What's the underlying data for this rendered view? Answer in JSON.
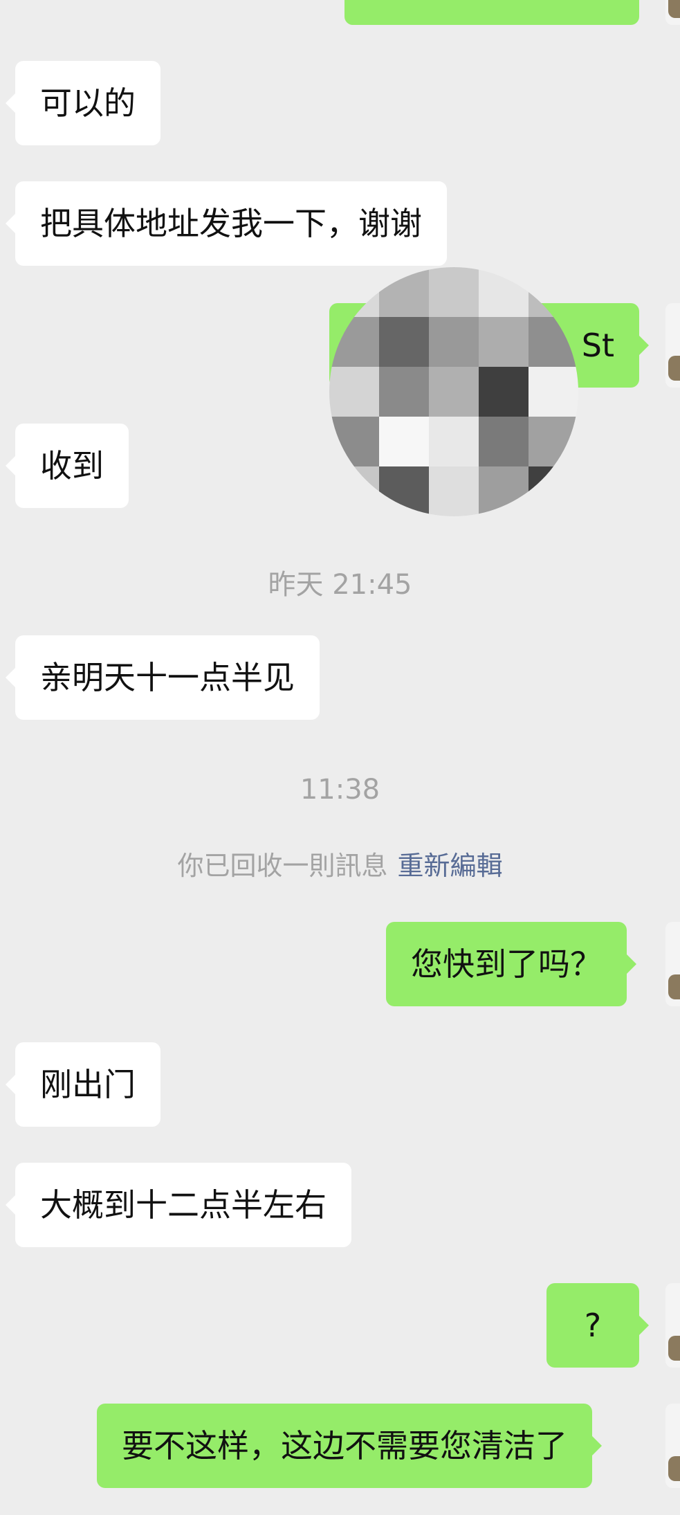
{
  "messages": [
    {
      "id": "m1",
      "side": "in",
      "text": "可以的"
    },
    {
      "id": "m2",
      "side": "in",
      "text": "把具体地址发我一下，谢谢"
    },
    {
      "id": "m3",
      "side": "out",
      "text": "St"
    },
    {
      "id": "m4",
      "side": "in",
      "text": "收到"
    },
    {
      "id": "m5",
      "side": "in",
      "text": "亲明天十一点半见"
    },
    {
      "id": "m6",
      "side": "out",
      "text": "您快到了吗？"
    },
    {
      "id": "m7",
      "side": "in",
      "text": "刚出门"
    },
    {
      "id": "m8",
      "side": "in",
      "text": "大概到十二点半左右"
    },
    {
      "id": "m9",
      "side": "out",
      "text": "?"
    },
    {
      "id": "m10",
      "side": "out",
      "text": "要不这样，这边不需要您清洁了"
    }
  ],
  "timestamps": {
    "yesterday": "昨天 21:45",
    "today": "11:38"
  },
  "recall_notice": {
    "text": "你已回收一則訊息",
    "action": "重新編輯"
  },
  "colors": {
    "background": "#ededed",
    "incoming_bubble": "#ffffff",
    "outgoing_bubble": "#95ec69",
    "link": "#576b95",
    "meta_text": "#a3a3a3"
  },
  "icons": {
    "avatar": "user-avatar",
    "redaction": "pixelated-mosaic"
  }
}
